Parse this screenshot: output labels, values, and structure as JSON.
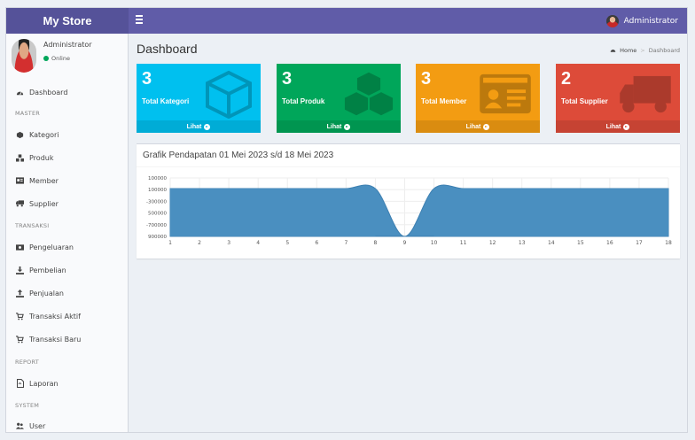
{
  "app": {
    "brand": "My Store"
  },
  "topbar": {
    "user_name": "Administrator"
  },
  "sidebar": {
    "user": {
      "name": "Administrator",
      "status": "Online"
    },
    "dashboard": "Dashboard",
    "headers": {
      "master": "MASTER",
      "transaksi": "TRANSAKSI",
      "report": "REPORT",
      "system": "SYSTEM"
    },
    "items": {
      "kategori": "Kategori",
      "produk": "Produk",
      "member": "Member",
      "supplier": "Supplier",
      "pengeluaran": "Pengeluaran",
      "pembelian": "Pembelian",
      "penjualan": "Penjualan",
      "transaksi_aktif": "Transaksi Aktif",
      "transaksi_baru": "Transaksi Baru",
      "laporan": "Laporan",
      "user": "User"
    }
  },
  "page": {
    "title": "Dashboard",
    "breadcrumb": {
      "home": "Home",
      "current": "Dashboard"
    }
  },
  "boxes": [
    {
      "value": "3",
      "label": "Total Kategori",
      "link": "Lihat",
      "color": "#00c0ef",
      "icon": "cube-icon"
    },
    {
      "value": "3",
      "label": "Total Produk",
      "link": "Lihat",
      "color": "#00a65a",
      "icon": "cubes-icon"
    },
    {
      "value": "3",
      "label": "Total Member",
      "link": "Lihat",
      "color": "#f39c12",
      "icon": "id-card-icon"
    },
    {
      "value": "2",
      "label": "Total Supplier",
      "link": "Lihat",
      "color": "#dd4b39",
      "icon": "truck-icon"
    }
  ],
  "chart": {
    "title": "Grafik Pendapatan 01 Mei 2023 s/d 18 Mei 2023"
  },
  "chart_data": {
    "type": "area",
    "x": [
      1,
      2,
      3,
      4,
      5,
      6,
      7,
      8,
      9,
      10,
      11,
      12,
      13,
      14,
      15,
      16,
      17,
      18
    ],
    "series": [
      {
        "values": [
          0,
          0,
          0,
          0,
          0,
          0,
          0,
          0,
          -900000,
          0,
          0,
          0,
          0,
          0,
          0,
          0,
          0,
          0
        ],
        "color": "#4a8fc0"
      }
    ],
    "yticks": [
      "100000",
      "100000",
      "-300000",
      "500000",
      "-700000",
      "900000"
    ],
    "ylim": [
      -900000,
      100000
    ],
    "grid": true
  }
}
